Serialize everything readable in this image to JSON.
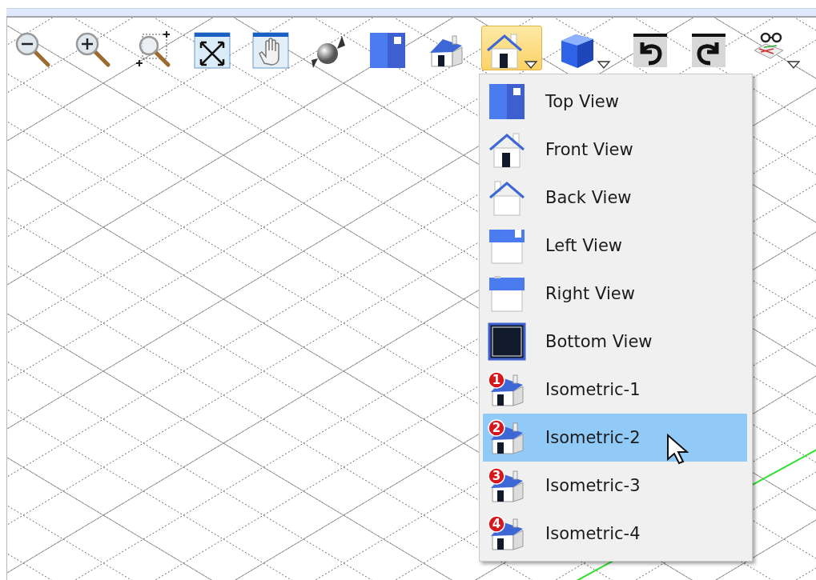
{
  "toolbar": [
    {
      "kind": "zoom-out",
      "selected": false,
      "has_menu": false
    },
    {
      "kind": "zoom-in",
      "selected": false,
      "has_menu": false
    },
    {
      "kind": "zoom-box",
      "selected": false,
      "has_menu": false
    },
    {
      "kind": "fit",
      "selected": false,
      "has_menu": false
    },
    {
      "kind": "pan",
      "selected": false,
      "has_menu": false
    },
    {
      "kind": "orbit",
      "selected": false,
      "has_menu": false
    },
    {
      "kind": "top",
      "selected": false,
      "has_menu": false
    },
    {
      "kind": "iso",
      "selected": false,
      "has_menu": false
    },
    {
      "kind": "front",
      "selected": true,
      "has_menu": true
    },
    {
      "kind": "cube",
      "selected": false,
      "has_menu": true
    },
    {
      "kind": "undo",
      "selected": false,
      "has_menu": false
    },
    {
      "kind": "redo",
      "selected": false,
      "has_menu": false
    },
    {
      "kind": "glasses",
      "selected": false,
      "has_menu": true
    }
  ],
  "view_menu": [
    {
      "kind": "top",
      "label": "Top View",
      "selected": false
    },
    {
      "kind": "front",
      "label": "Front View",
      "selected": false
    },
    {
      "kind": "back",
      "label": "Back View",
      "selected": false
    },
    {
      "kind": "left",
      "label": "Left View",
      "selected": false
    },
    {
      "kind": "right",
      "label": "Right View",
      "selected": false
    },
    {
      "kind": "bottom",
      "label": "Bottom View",
      "selected": false
    },
    {
      "kind": "iso",
      "label": "Isometric-1",
      "badge": "1",
      "selected": false
    },
    {
      "kind": "iso",
      "label": "Isometric-2",
      "badge": "2",
      "selected": true
    },
    {
      "kind": "iso",
      "label": "Isometric-3",
      "badge": "3",
      "selected": false
    },
    {
      "kind": "iso",
      "label": "Isometric-4",
      "badge": "4",
      "selected": false
    }
  ]
}
